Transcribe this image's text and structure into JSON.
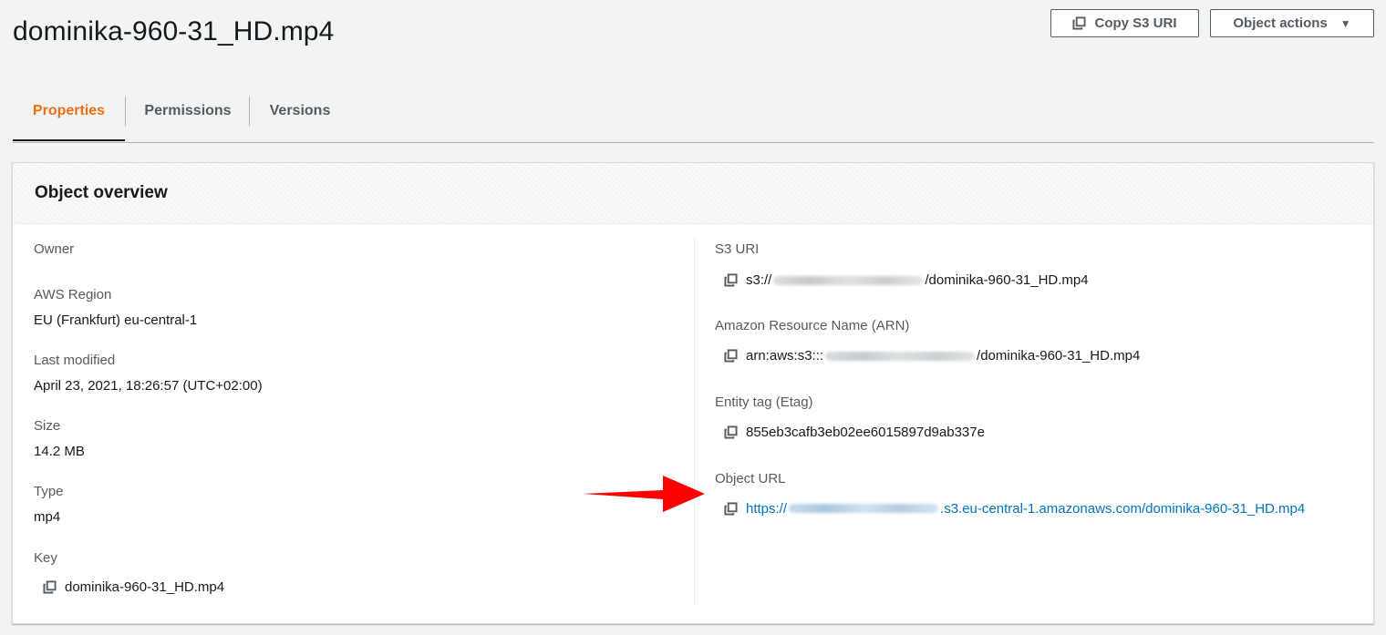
{
  "page": {
    "title": "dominika-960-31_HD.mp4"
  },
  "header_actions": {
    "copy_uri_label": "Copy S3 URI",
    "object_actions_label": "Object actions"
  },
  "tabs": [
    {
      "label": "Properties",
      "active": true
    },
    {
      "label": "Permissions",
      "active": false
    },
    {
      "label": "Versions",
      "active": false
    }
  ],
  "overview": {
    "title": "Object overview",
    "left": {
      "owner_label": "Owner",
      "owner_value": "",
      "region_label": "AWS Region",
      "region_value": "EU (Frankfurt) eu-central-1",
      "modified_label": "Last modified",
      "modified_value": "April 23, 2021, 18:26:57 (UTC+02:00)",
      "size_label": "Size",
      "size_value": "14.2 MB",
      "type_label": "Type",
      "type_value": "mp4",
      "key_label": "Key",
      "key_value": "dominika-960-31_HD.mp4"
    },
    "right": {
      "s3uri_label": "S3 URI",
      "s3uri_prefix": "s3://",
      "s3uri_suffix": "/dominika-960-31_HD.mp4",
      "arn_label": "Amazon Resource Name (ARN)",
      "arn_prefix": "arn:aws:s3:::",
      "arn_suffix": "/dominika-960-31_HD.mp4",
      "etag_label": "Entity tag (Etag)",
      "etag_value": "855eb3cafb3eb02ee6015897d9ab337e",
      "url_label": "Object URL",
      "url_prefix": "https://",
      "url_suffix": ".s3.eu-central-1.amazonaws.com/dominika-960-31_HD.mp4"
    }
  },
  "colors": {
    "accent": "#ec7211",
    "link": "#0073bb",
    "annotation_arrow": "#ff0000"
  },
  "icons": [
    "copy-icon",
    "caret-down-icon",
    "red-arrow-annotation"
  ]
}
